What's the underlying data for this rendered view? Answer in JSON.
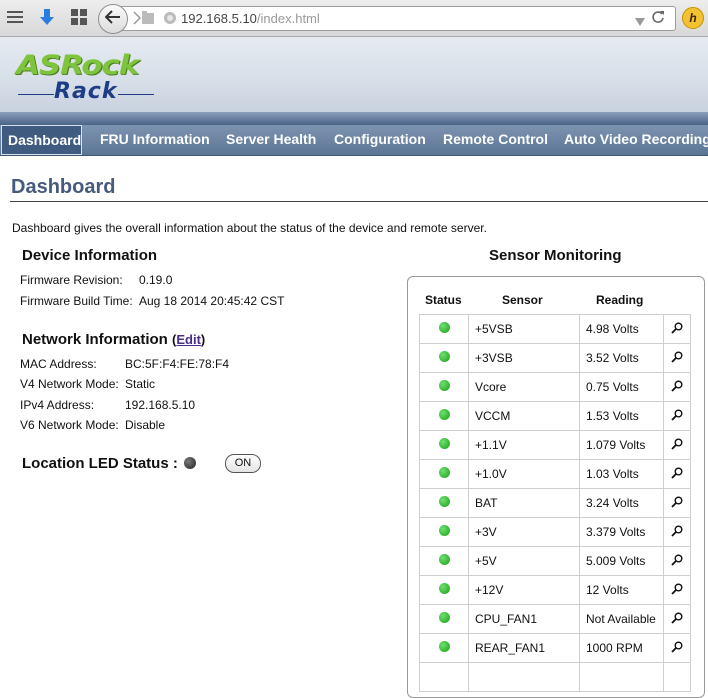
{
  "browser": {
    "url_host": "192.168.5.10",
    "url_path": "/index.html",
    "h_label": "h"
  },
  "logo": {
    "top": "ASRock",
    "bottom": "Rack"
  },
  "nav": {
    "items": [
      "Dashboard",
      "FRU Information",
      "Server Health",
      "Configuration",
      "Remote Control",
      "Auto Video Recording"
    ],
    "active": "Dashboard"
  },
  "page": {
    "title": "Dashboard",
    "description": "Dashboard gives the overall information about the status of the device and remote server."
  },
  "device": {
    "heading": "Device Information",
    "firmware_revision_label": "Firmware Revision:",
    "firmware_revision": "0.19.0",
    "build_time_label": "Firmware Build Time:",
    "build_time": "Aug 18 2014 20:45:42 CST"
  },
  "network": {
    "heading": "Network Information",
    "edit_label": "Edit",
    "mac_label": "MAC Address:",
    "mac": "BC:5F:F4:FE:78:F4",
    "v4_mode_label": "V4 Network Mode:",
    "v4_mode": "Static",
    "ipv4_label": "IPv4 Address:",
    "ipv4": "192.168.5.10",
    "v6_mode_label": "V6 Network Mode:",
    "v6_mode": "Disable"
  },
  "led": {
    "label": "Location LED Status :",
    "button": "ON"
  },
  "sensors": {
    "heading": "Sensor Monitoring",
    "columns": [
      "Status",
      "Sensor",
      "Reading"
    ],
    "rows": [
      {
        "name": "+5VSB",
        "reading": "4.98 Volts"
      },
      {
        "name": "+3VSB",
        "reading": "3.52 Volts"
      },
      {
        "name": "Vcore",
        "reading": "0.75 Volts"
      },
      {
        "name": "VCCM",
        "reading": "1.53 Volts"
      },
      {
        "name": "+1.1V",
        "reading": "1.079 Volts"
      },
      {
        "name": "+1.0V",
        "reading": "1.03 Volts"
      },
      {
        "name": "BAT",
        "reading": "3.24 Volts"
      },
      {
        "name": "+3V",
        "reading": "3.379 Volts"
      },
      {
        "name": "+5V",
        "reading": "5.009 Volts"
      },
      {
        "name": "+12V",
        "reading": "12 Volts"
      },
      {
        "name": "CPU_FAN1",
        "reading": "Not Available"
      },
      {
        "name": "REAR_FAN1",
        "reading": "1000 RPM"
      },
      {
        "name": "",
        "reading": ""
      }
    ]
  },
  "colors": {
    "status_ok": "#22aa22",
    "nav_bg": "#6b84a3",
    "title": "#465c7a",
    "logo_green": "#7ec43d",
    "logo_blue": "#1d3e86"
  }
}
